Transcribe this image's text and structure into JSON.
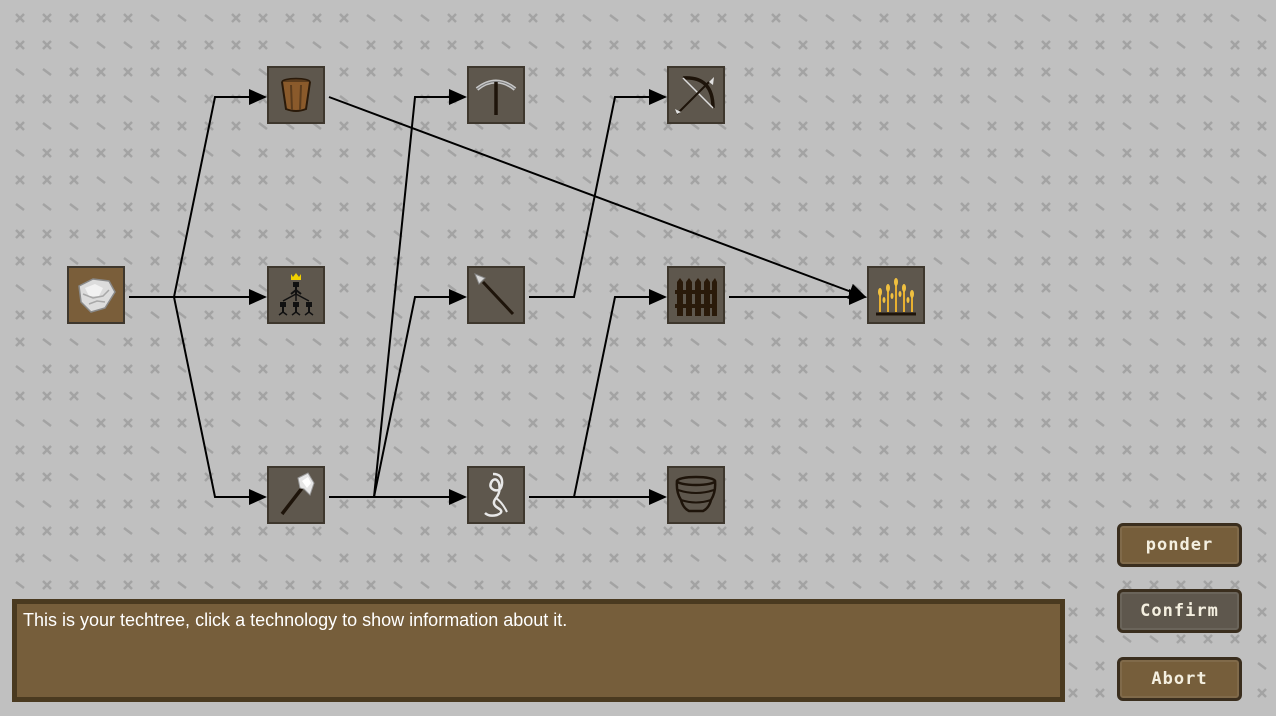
{
  "colors": {
    "background": "#c0c0c0",
    "pattern": "#a3a3a3",
    "edge": "#000000",
    "node_locked": "#5e574d",
    "node_unlocked": "#7a5e3a",
    "node_border": "#3e372d",
    "panel": "#765e3b",
    "panel_border": "#4a3a20",
    "button_brown": "#765e3b",
    "button_gray": "#5e574d",
    "button_text": "#f4efe0"
  },
  "techtree": {
    "nodes": [
      {
        "id": "flint",
        "icon": "flint-stone-icon",
        "unlocked": true
      },
      {
        "id": "bucket",
        "icon": "bucket-icon",
        "unlocked": false
      },
      {
        "id": "leadership",
        "icon": "leadership-hierarchy-icon",
        "unlocked": false
      },
      {
        "id": "axe",
        "icon": "stone-axe-icon",
        "unlocked": false
      },
      {
        "id": "pickaxe",
        "icon": "pickaxe-icon",
        "unlocked": false
      },
      {
        "id": "spear",
        "icon": "spear-icon",
        "unlocked": false
      },
      {
        "id": "rope",
        "icon": "rope-icon",
        "unlocked": false
      },
      {
        "id": "bow",
        "icon": "bow-icon",
        "unlocked": false
      },
      {
        "id": "fence",
        "icon": "fence-icon",
        "unlocked": false
      },
      {
        "id": "basket",
        "icon": "basket-icon",
        "unlocked": false
      },
      {
        "id": "farming",
        "icon": "wheat-farming-icon",
        "unlocked": false
      }
    ],
    "edges": [
      [
        "flint",
        "bucket"
      ],
      [
        "flint",
        "leadership"
      ],
      [
        "flint",
        "axe"
      ],
      [
        "axe",
        "pickaxe"
      ],
      [
        "axe",
        "spear"
      ],
      [
        "axe",
        "rope"
      ],
      [
        "spear",
        "bow"
      ],
      [
        "rope",
        "fence"
      ],
      [
        "rope",
        "basket"
      ],
      [
        "bucket",
        "farming"
      ],
      [
        "fence",
        "farming"
      ]
    ]
  },
  "info_panel": {
    "text": "This is your techtree, click a technology to show information about it."
  },
  "buttons": {
    "ponder": "ponder",
    "confirm": "Confirm",
    "abort": "Abort"
  }
}
